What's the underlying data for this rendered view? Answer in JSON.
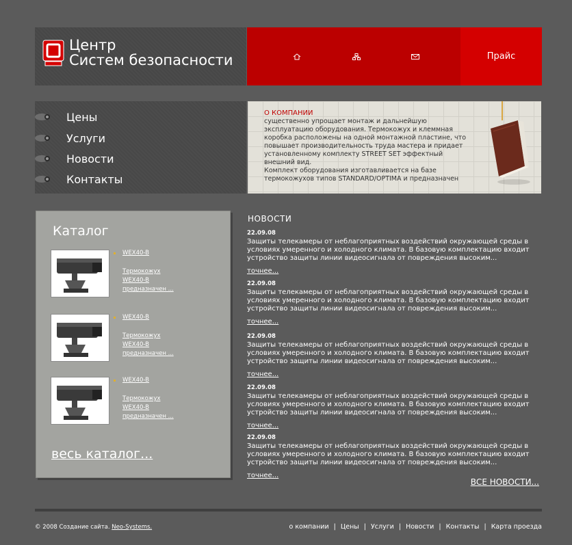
{
  "header": {
    "logo_line1": "Центр",
    "logo_line2": "Систем безопасности",
    "nav_icons": [
      "home-icon",
      "sitemap-icon",
      "mail-icon"
    ],
    "price_label": "Прайс"
  },
  "menu": {
    "items": [
      {
        "label": "Цены"
      },
      {
        "label": "Услуги"
      },
      {
        "label": "Новости"
      },
      {
        "label": "Контакты"
      }
    ]
  },
  "about": {
    "title": "О КОМПАНИИ",
    "text_lines": [
      "существенно упрощает монтаж и дальнейшую",
      "эксплуатацию оборудования. Термокожух и клеммная",
      "коробка расположены на одной монтажной пластине, что",
      "повышает производительность труда мастера и придает",
      "установленному комплекту STREET SET эффектный",
      "внешний вид.",
      "Комплект оборудования изготавливается на базе",
      "термокожухов типов STANDARD/OPTIMA и предназначен"
    ]
  },
  "catalog": {
    "title": "Каталог",
    "items": [
      {
        "name": "WEX40-B",
        "desc_lines": [
          "Термокожух",
          "WEX40-B",
          "предназначен ..."
        ]
      },
      {
        "name": "WEX40-B",
        "desc_lines": [
          "Термокожух",
          "WEX40-B",
          "предназначен ..."
        ]
      },
      {
        "name": "WEX40-B",
        "desc_lines": [
          "Термокожух",
          "WEX40-B",
          "предназначен ..."
        ]
      }
    ],
    "all_link": "весь каталог..."
  },
  "news": {
    "title": "НОВОСТИ",
    "items": [
      {
        "date": "22.09.08",
        "lines": [
          "Защиты телекамеры от неблагоприятных воздействий окружающей среды в",
          "условиях умеренного и холодного климата. В базовую комплектацию входит",
          "устройство защиты линии видеосигнала от повреждения высоким..."
        ],
        "more": "точнее..."
      },
      {
        "date": "22.09.08",
        "lines": [
          "Защиты телекамеры от неблагоприятных воздействий окружающей среды в",
          "условиях умеренного и холодного климата. В базовую комплектацию входит",
          "устройство защиты линии видеосигнала от повреждения высоким..."
        ],
        "more": "точнее..."
      },
      {
        "date": "22.09.08",
        "lines": [
          "Защиты телекамеры от неблагоприятных воздействий окружающей среды в",
          "условиях умеренного и холодного климата. В базовую комплектацию входит",
          "устройство защиты линии видеосигнала от повреждения высоким..."
        ],
        "more": "точнее..."
      },
      {
        "date": "22.09.08",
        "lines": [
          "Защиты телекамеры от неблагоприятных воздействий окружающей среды в",
          "условиях умеренного и холодного климата. В базовую комплектацию входит",
          "устройство защиты линии видеосигнала от повреждения высоким..."
        ],
        "more": "точнее..."
      },
      {
        "date": "22.09.08",
        "lines": [
          "Защиты телекамеры от неблагоприятных воздействий окружающей среды в",
          "условиях умеренного и холодного климата. В базовую комплектацию входит",
          "устройство защиты линии видеосигнала от повреждения высоким..."
        ],
        "more": "точнее..."
      }
    ],
    "all_link": "ВСЕ НОВОСТИ..."
  },
  "footer": {
    "copyright_prefix": "© 2008 Создание сайта.",
    "copyright_link": "Neo-Systems.",
    "nav": [
      "о компании",
      "Цены",
      "Услуги",
      "Новости",
      "Контакты",
      "Карта проезда"
    ],
    "separator": "|"
  },
  "colors": {
    "background": "#5b5b5b",
    "header_red": "#bb0000",
    "price_red": "#d40000",
    "accent_text": "#c00000",
    "catalog_panel": "#a3a4a0"
  }
}
